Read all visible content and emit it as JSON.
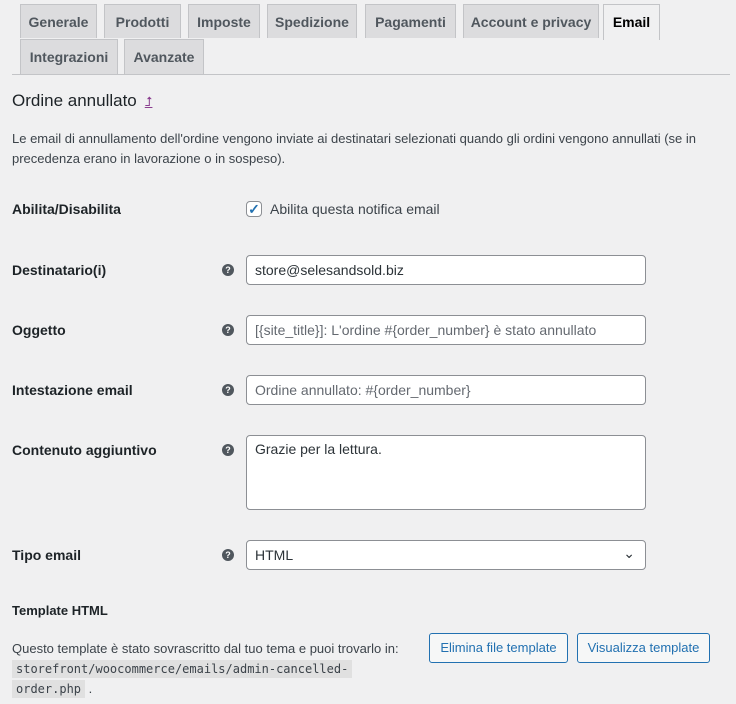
{
  "tabs": [
    "Generale",
    "Prodotti",
    "Imposte",
    "Spedizione",
    "Pagamenti",
    "Account e privacy",
    "Email",
    "Integrazioni",
    "Avanzate"
  ],
  "active_tab": "Email",
  "title": "Ordine annullato",
  "up_link": "⮥",
  "description": "Le email di annullamento dell'ordine vengono inviate ai destinatari selezionati quando gli ordini vengono annullati (se in precedenza erano in lavorazione o in sospeso).",
  "fields": {
    "enable": {
      "label": "Abilita/Disabilita",
      "checkbox_label": "Abilita questa notifica email",
      "checked": true
    },
    "recipient": {
      "label": "Destinatario(i)",
      "value": "store@selesandsold.biz"
    },
    "subject": {
      "label": "Oggetto",
      "placeholder": "[{site_title}]: L'ordine #{order_number} è stato annullato"
    },
    "heading": {
      "label": "Intestazione email",
      "placeholder": "Ordine annullato: #{order_number}"
    },
    "additional": {
      "label": "Contenuto aggiuntivo",
      "value": "Grazie per la lettura."
    },
    "type": {
      "label": "Tipo email",
      "value": "HTML"
    }
  },
  "template": {
    "heading": "Template HTML",
    "text": "Questo template è stato sovrascritto dal tuo tema e puoi trovarlo in:",
    "path1": "storefront/woocommerce/emails/admin-cancelled-",
    "path2": "order.php",
    "suffix": ".",
    "delete_button": "Elimina file template",
    "view_button": "Visualizza template"
  },
  "help_icon": "?"
}
